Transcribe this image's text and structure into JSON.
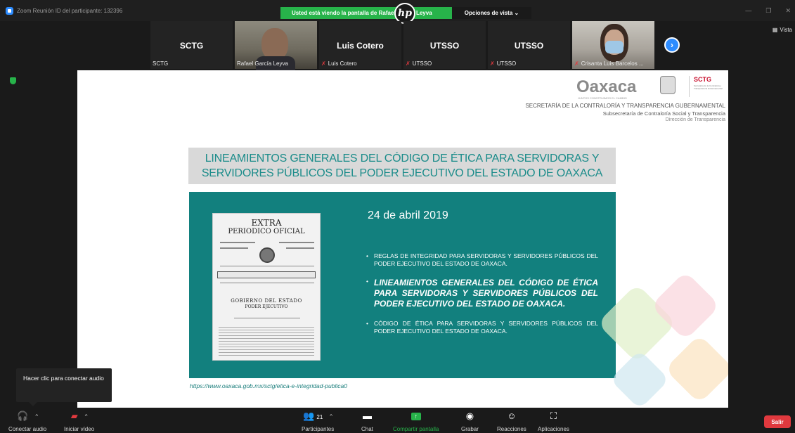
{
  "window": {
    "title": "Zoom Reunión ID del participante: 132396",
    "share_banner": "Usted está viendo la pantalla de Rafael García Leyva",
    "view_options": "Opciones de vista ⌄",
    "hp_logo_text": "hp",
    "controls": [
      "—",
      "❐",
      "✕"
    ]
  },
  "participants": [
    {
      "big": "SCTG",
      "name": "SCTG",
      "muted": false,
      "video": false
    },
    {
      "big": "",
      "name": "Rafael García Leyva",
      "muted": false,
      "video": true
    },
    {
      "big": "Luis Cotero",
      "name": "Luis Cotero",
      "muted": true,
      "video": false
    },
    {
      "big": "UTSSO",
      "name": "UTSSO",
      "muted": true,
      "video": false
    },
    {
      "big": "UTSSO",
      "name": "UTSSO",
      "muted": true,
      "video": false
    },
    {
      "big": "",
      "name": "Crisanta Luis Barcelos ...",
      "muted": true,
      "video": true
    }
  ],
  "strip_next": "›",
  "vista": "Vista",
  "slide": {
    "logo": "Oaxaca",
    "logo_sub": "JUNTOS CONSTRUIMOS EL CAMBIO",
    "sctg": "SCTG",
    "sctg_sub": "Secretaría de la Contraloría y Transparencia Gubernamental",
    "header_1": "SECRETARÍA DE LA CONTRALORÍA Y TRANSPARENCIA GUBERNAMENTAL",
    "header_2": "Subsecretaría de Contraloría Social y Transparencia",
    "header_3": "Dirección de Transparencia",
    "title_line1": "LINEAMIENTOS GENERALES DEL CÓDIGO DE ÉTICA PARA SERVIDORAS Y",
    "title_line2": "SERVIDORES PÚBLICOS DEL PODER EJECUTIVO DEL ESTADO DE OAXACA",
    "doc_line1": "EXTRA",
    "doc_line2": "PERIODICO OFICIAL",
    "doc_line3": "GOBIERNO DEL ESTADO",
    "doc_line4": "PODER EJECUTIVO",
    "date": "24 de abril 2019",
    "bullets": [
      "REGLAS DE INTEGRIDAD PARA SERVIDORAS Y SERVIDORES PÚBLICOS DEL PODER EJECUTIVO DEL ESTADO DE OAXACA.",
      "LINEAMIENTOS GENERALES DEL CÓDIGO DE ÉTICA PARA SERVIDORAS Y SERVIDORES PÚBLICOS DEL PODER EJECUTIVO DEL ESTADO DE OAXACA.",
      "CÓDIGO DE ÉTICA PARA SERVIDORAS Y SERVIDORES PÚBLICOS DEL PODER EJECUTIVO DEL ESTADO DE OAXACA."
    ],
    "bullet_mark": "•",
    "url": "https://www.oaxaca.gob.mx/sctg/etica-e-integridad-publica0"
  },
  "tooltip": "Hacer clic para conectar audio",
  "toolbar": {
    "audio": "Conectar audio",
    "video": "Iniciar vídeo",
    "participants": "Participantes",
    "participants_count": "21",
    "chat": "Chat",
    "share": "Compartir pantalla",
    "record": "Grabar",
    "reactions": "Reacciones",
    "apps": "Aplicaciones",
    "leave": "Salir"
  },
  "colors": {
    "accent_green": "#27b34a",
    "teal": "#12807e",
    "leave_red": "#e0393e",
    "zoom_blue": "#2d8cff"
  }
}
